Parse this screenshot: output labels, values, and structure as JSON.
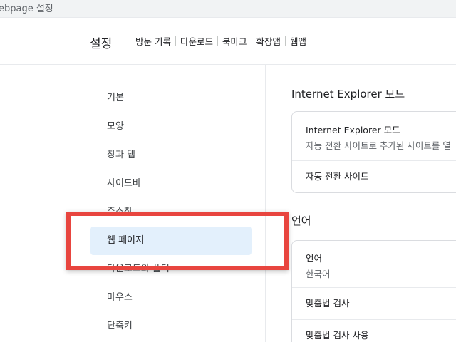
{
  "window": {
    "title": "ebpage  설정"
  },
  "header": {
    "title": "설정",
    "nav": [
      {
        "label": "방문 기록"
      },
      {
        "label": "다운로드"
      },
      {
        "label": "북마크"
      },
      {
        "label": "확장앱"
      },
      {
        "label": "웹앱"
      }
    ]
  },
  "sidebar": {
    "items": [
      {
        "label": "기본"
      },
      {
        "label": "모양"
      },
      {
        "label": "창과 탭"
      },
      {
        "label": "사이드바"
      },
      {
        "label": "주소창"
      },
      {
        "label": "웹 페이지",
        "active": true
      },
      {
        "label": "다운로드와 폴더"
      },
      {
        "label": "마우스"
      },
      {
        "label": "단축키"
      }
    ]
  },
  "main": {
    "ie_section": {
      "title": "Internet Explorer 모드",
      "rows": [
        {
          "primary": "Internet Explorer 모드",
          "secondary": "자동 전환 사이트로 추가된 사이트를 열"
        },
        {
          "primary": "자동 전환 사이트"
        }
      ]
    },
    "language_section": {
      "title": "언어",
      "rows": [
        {
          "primary": "언어",
          "secondary": "한국어"
        },
        {
          "primary": "맞춤법 검사"
        },
        {
          "primary": "맞춤법 검사 사용"
        }
      ]
    }
  },
  "annotation": {
    "highlight_color": "#e8453f"
  }
}
